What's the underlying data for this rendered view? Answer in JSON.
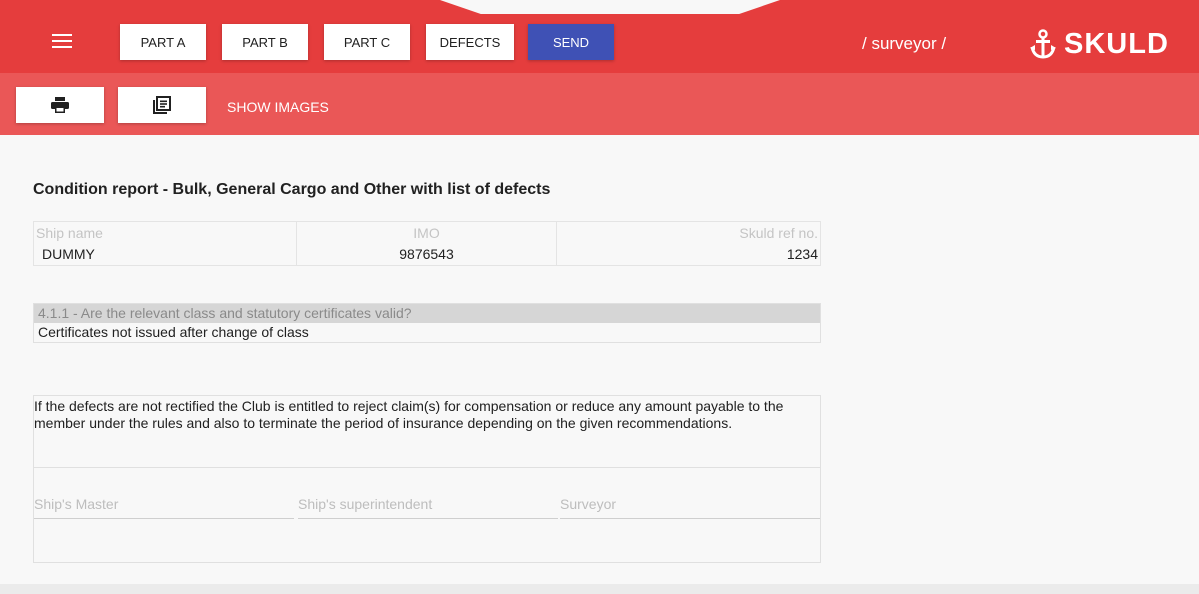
{
  "header": {
    "tabs": [
      {
        "label": "PART A"
      },
      {
        "label": "PART B"
      },
      {
        "label": "PART C"
      },
      {
        "label": "DEFECTS"
      },
      {
        "label": "SEND"
      }
    ],
    "user_path": "/ surveyor /",
    "logo_text": "SKULD",
    "accent_color": "#e53d3d",
    "send_color": "#3f51b5"
  },
  "toolbar": {
    "print_icon": "print-icon",
    "list_icon": "library-books-icon",
    "show_images_label": "SHOW IMAGES"
  },
  "report": {
    "title": "Condition report - Bulk, General Cargo and Other with list of defects",
    "ship": {
      "headers": [
        "Ship name",
        "IMO",
        "Skuld ref no."
      ],
      "values": [
        "DUMMY",
        "9876543",
        "1234"
      ]
    },
    "question": "4.1.1 - Are the relevant class and statutory certificates valid?",
    "answer": "Certificates not issued after change of class",
    "disclaimer": "If the defects are not rectified the Club is entitled to reject claim(s) for compensation or reduce any amount payable to the member under the rules and also to terminate the period of insurance depending on the given recommendations.",
    "signatures": [
      "Ship's Master",
      "Ship's superintendent",
      "Surveyor"
    ]
  }
}
